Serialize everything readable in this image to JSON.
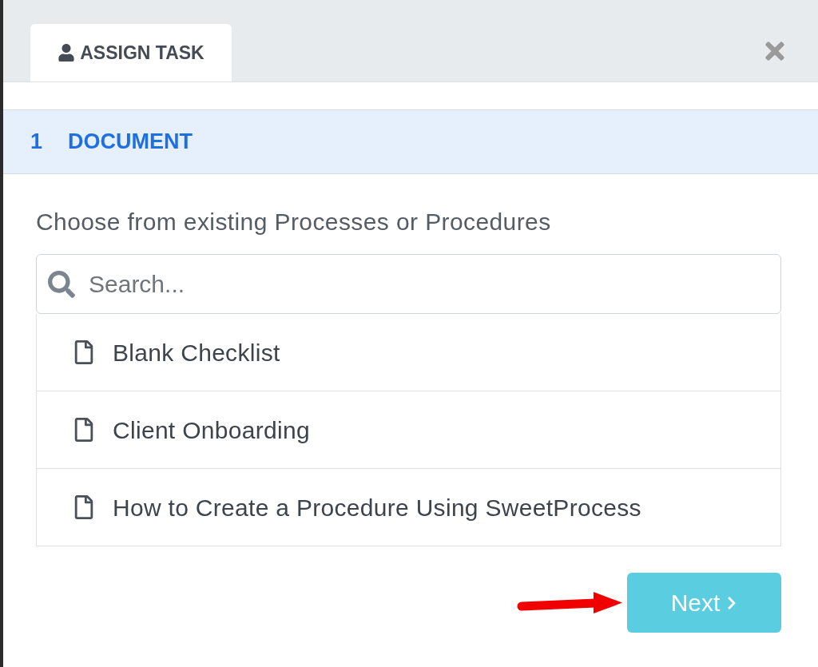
{
  "header": {
    "tabs": [
      {
        "label": "ASSIGN TASK",
        "selected": true
      }
    ]
  },
  "step": {
    "number": "1",
    "label": "DOCUMENT",
    "active": true
  },
  "prompt": "Choose from existing Processes or Procedures",
  "search": {
    "placeholder": "Search..."
  },
  "documents": [
    {
      "label": "Blank Checklist"
    },
    {
      "label": "Client Onboarding"
    },
    {
      "label": "How to Create a Procedure Using SweetProcess"
    }
  ],
  "next_button": {
    "label": "Next"
  }
}
